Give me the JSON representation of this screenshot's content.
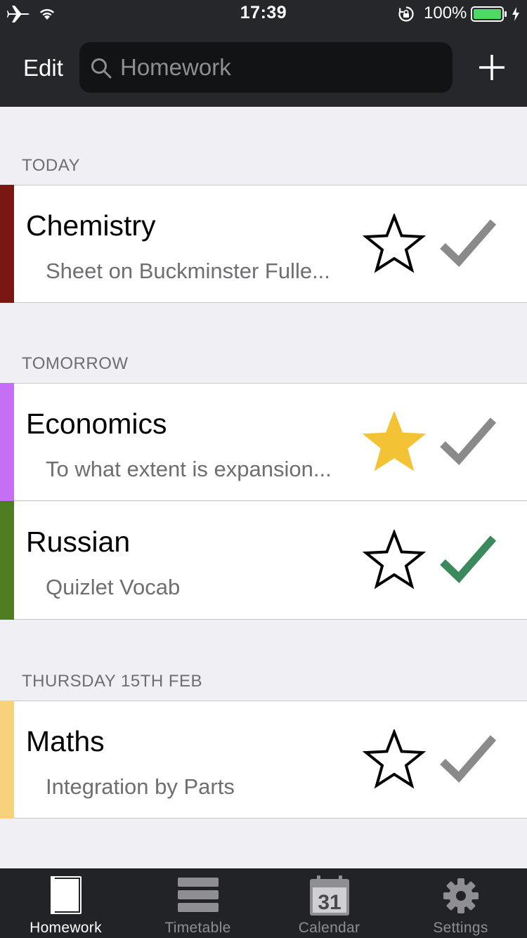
{
  "status_bar": {
    "time": "17:39",
    "battery_percent": "100%",
    "battery_level": 1.0,
    "battery_color": "#4cd964"
  },
  "nav": {
    "edit_label": "Edit",
    "search_placeholder": "Homework",
    "add_icon": "plus-icon"
  },
  "sections": [
    {
      "header": "TODAY",
      "items": [
        {
          "subject": "Chemistry",
          "description": "Sheet on Buckminster Fulle...",
          "color": "#7a1712",
          "starred": false,
          "done": false
        }
      ]
    },
    {
      "header": "TOMORROW",
      "items": [
        {
          "subject": "Economics",
          "description": "To what extent is expansion...",
          "color": "#c56ff5",
          "starred": true,
          "done": false
        },
        {
          "subject": "Russian",
          "description": "Quizlet Vocab",
          "color": "#4f7e22",
          "starred": false,
          "done": true
        }
      ]
    },
    {
      "header": "THURSDAY 15TH FEB",
      "items": [
        {
          "subject": "Maths",
          "description": "Integration by Parts",
          "color": "#f7d27a",
          "starred": false,
          "done": false
        }
      ]
    }
  ],
  "colors": {
    "star_filled": "#f4c235",
    "check_done": "#3a8a5e",
    "check_pending": "#8a8a8a"
  },
  "tabs": [
    {
      "label": "Homework",
      "icon": "book-icon",
      "active": true
    },
    {
      "label": "Timetable",
      "icon": "timetable-icon",
      "active": false
    },
    {
      "label": "Calendar",
      "icon": "calendar-icon",
      "calendar_day": "31",
      "active": false
    },
    {
      "label": "Settings",
      "icon": "gear-icon",
      "active": false
    }
  ]
}
